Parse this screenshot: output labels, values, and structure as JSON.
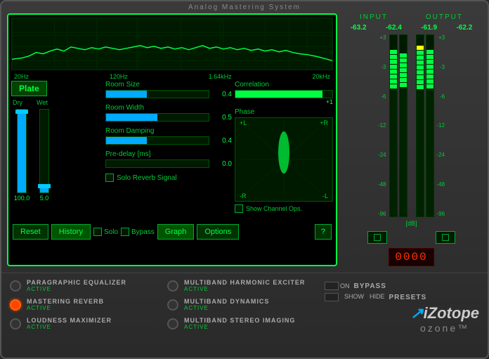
{
  "app": {
    "title": "Analog Mastering System"
  },
  "spectrum": {
    "freq_labels": [
      "20Hz",
      "120Hz",
      "1.64kHz",
      "20kHz"
    ]
  },
  "preset": {
    "name": "Plate"
  },
  "controls": {
    "dry_wet_label_dry": "Dry",
    "dry_wet_label_wet": "Wet",
    "dry_value": "100.0",
    "wet_value": "5.0",
    "room_size_label": "Room Size",
    "room_size_value": "0.4",
    "room_width_label": "Room Width",
    "room_width_value": "0.5",
    "room_damping_label": "Room Damping",
    "room_damping_value": "0.4",
    "pre_delay_label": "Pre-delay [ms]",
    "pre_delay_value": "0.0",
    "solo_reverb_label": "Solo Reverb Signal"
  },
  "correlation": {
    "label": "Correlation",
    "value": "+1"
  },
  "phase": {
    "label": "Phase",
    "left": "+L",
    "right": "+R",
    "bottom_left": "-R",
    "bottom_right": "-L"
  },
  "show_channel_ops": {
    "label": "Show Channel Ops."
  },
  "bottom_buttons": {
    "reset": "Reset",
    "history": "History",
    "solo": "Solo",
    "bypass": "Bypass",
    "graph": "Graph",
    "options": "Options",
    "help": "?"
  },
  "input_meter": {
    "label": "INPUT",
    "left_value": "-63.2",
    "right_value": "-62.4"
  },
  "output_meter": {
    "label": "OUTPUT",
    "left_value": "-61.9",
    "right_value": "-62.2"
  },
  "db_scale": {
    "values": [
      "+3",
      "-3",
      "-6",
      "-12",
      "-24",
      "-48",
      "-96"
    ]
  },
  "db_label": "[dB]",
  "digital_display": "0000",
  "modules": {
    "left": [
      {
        "name": "PARAGRAPHIC EQUALIZER",
        "status": "ACTIVE",
        "active": false
      },
      {
        "name": "MASTERING REVERB",
        "status": "ACTIVE",
        "active": true
      },
      {
        "name": "LOUDNESS MAXIMIZER",
        "status": "ACTIVE",
        "active": false
      }
    ],
    "right": [
      {
        "name": "MULTIBAND HARMONIC EXCITER",
        "status": "ACTIVE",
        "active": false
      },
      {
        "name": "MULTIBAND DYNAMICS",
        "status": "ACTIVE",
        "active": false
      },
      {
        "name": "MULTIBAND STEREO IMAGING",
        "status": "ACTIVE",
        "active": false
      }
    ]
  },
  "bypass": {
    "label": "BYPASS",
    "on_label": "ON"
  },
  "presets": {
    "label": "PRESETS",
    "show": "SHOW",
    "hide": "HIDE"
  },
  "brand": {
    "name": "iZotope",
    "product": "ozone",
    "tm": "™"
  },
  "meter_buttons": {
    "input_btn": "■",
    "output_btn": "■"
  }
}
